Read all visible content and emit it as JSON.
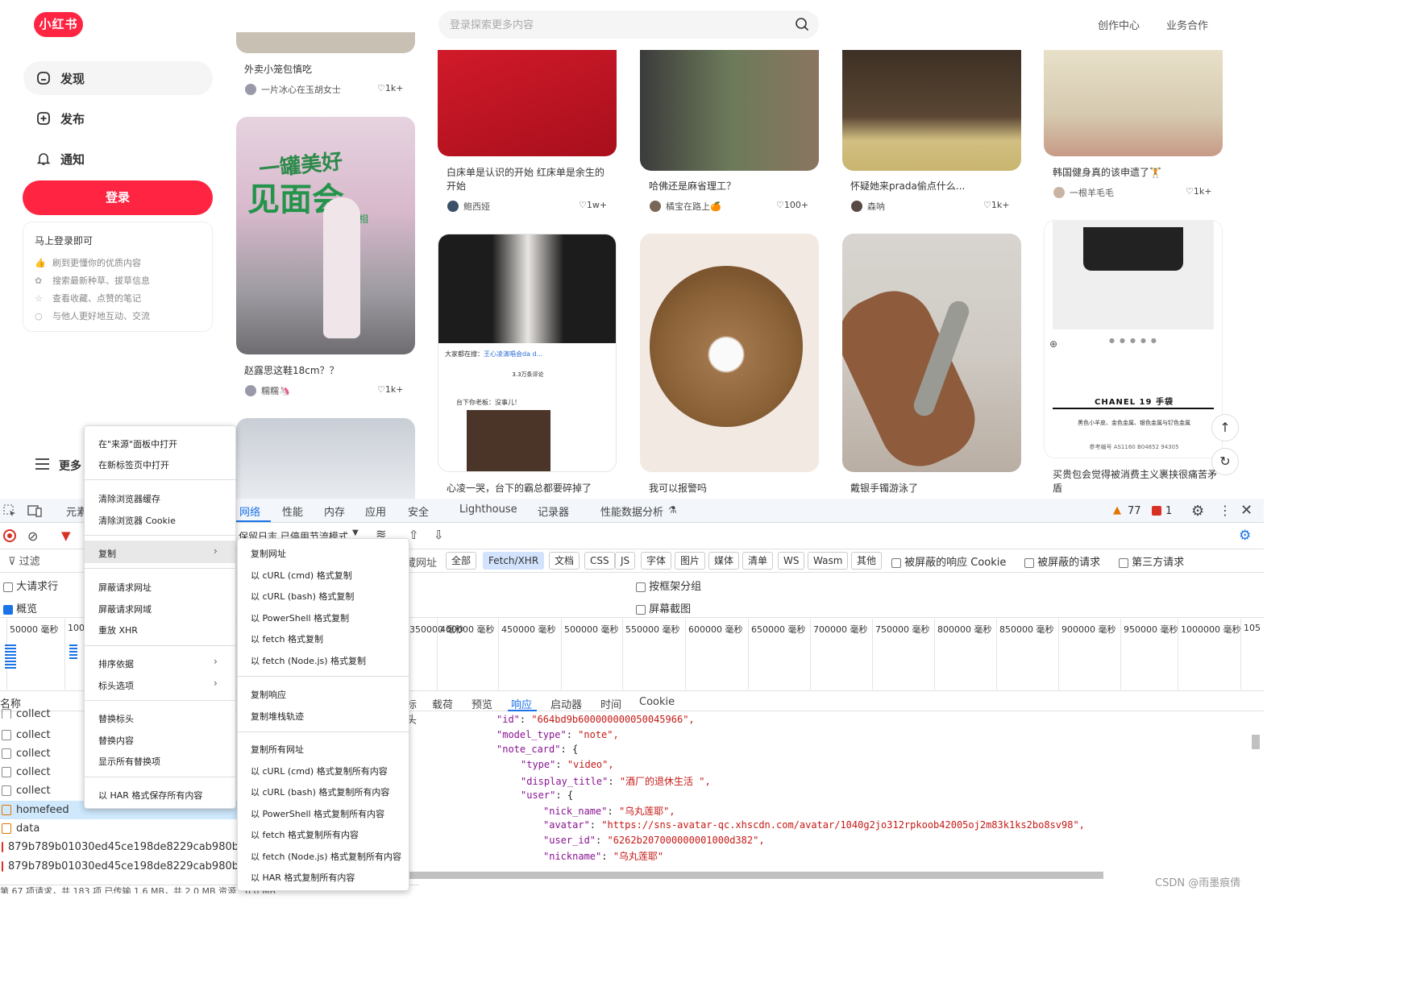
{
  "app": {
    "logo": "小红书"
  },
  "sidebar": {
    "items": [
      {
        "label": "发现"
      },
      {
        "label": "发布"
      },
      {
        "label": "通知"
      }
    ],
    "login_label": "登录",
    "login_card": {
      "title": "马上登录即可",
      "rows": [
        "刷到更懂你的优质内容",
        "搜索最新种草、拔草信息",
        "查看收藏、点赞的笔记",
        "与他人更好地互动、交流"
      ]
    },
    "more_label": "更多"
  },
  "search": {
    "placeholder": "登录探索更多内容"
  },
  "header_links": [
    "创作中心",
    "业务合作"
  ],
  "feed": {
    "cards": [
      {
        "title": "外卖小笼包慎吃",
        "author": "一片冰心在玉胡女士",
        "likes": "1k+"
      },
      {
        "title": "赵露思这鞋18cm？？",
        "author": "糯糯🦄",
        "likes": "1k+"
      },
      {
        "title": "白床单是认识的开始 红床单是余生的开始",
        "author": "鲍西娅",
        "likes": "1w+"
      },
      {
        "title": "心凌一哭，台下的霸总都要碎掉了",
        "author": "",
        "likes": ""
      },
      {
        "title": "哈佛还是麻省理工？",
        "author": "橘宝在路上🍊",
        "likes": "100+"
      },
      {
        "title": "我可以报警吗",
        "author": "",
        "likes": ""
      },
      {
        "title": "怀疑她来prada偷点什么...",
        "author": "森呐",
        "likes": "1k+"
      },
      {
        "title": "戴银手镯游泳了",
        "author": "",
        "likes": ""
      },
      {
        "title": "韩国健身真的该申遗了🏋️",
        "author": "一根羊毛毛",
        "likes": "1k+"
      },
      {
        "title": "买贵包会觉得被消费主义裹挟很痛苦矛盾",
        "author": "",
        "likes": ""
      }
    ],
    "poster_text": {
      "a": "一罐美好",
      "b": "见面会",
      "c": "约你相"
    },
    "screenshot_text": {
      "search_prefix": "大家都在搜：",
      "search_term": "王心凌演唱会da d...",
      "comment_count": "3.3万条评论",
      "comment_text": "台下你老板：没事儿！"
    },
    "chanel": {
      "title": "CHANEL 19 手袋",
      "desc": "黑色小羊皮、金色金属、银色金属与钌色金属",
      "ref": "参考编号 AS1160 B04852 94305"
    }
  },
  "devtools": {
    "tabs": [
      "元素",
      "网络",
      "性能",
      "内存",
      "应用",
      "安全",
      "Lighthouse",
      "记录器",
      "性能数据分析"
    ],
    "active_tab": "网络",
    "warnings": "77",
    "errors": "1",
    "toolbar": {
      "preserve_log": "保留日志",
      "disable_cache": "已停用节流模式"
    },
    "filter_placeholder": "过滤",
    "filter_types": [
      "全部",
      "Fetch/XHR",
      "文档",
      "CSS",
      "JS",
      "字体",
      "图片",
      "媒体",
      "清单",
      "WS",
      "Wasm",
      "其他"
    ],
    "filter_checks": [
      "被屏蔽的响应 Cookie",
      "被屏蔽的请求",
      "第三方请求"
    ],
    "hide_url": "隐藏网址",
    "big_rows": "大请求行",
    "overview": "概览",
    "group_by_frame": "按框架分组",
    "screenshots": "屏幕截图",
    "timeline_ticks": [
      "50000 毫秒",
      "1000",
      "350000 毫秒",
      "400000 毫秒",
      "450000 毫秒",
      "500000 毫秒",
      "550000 毫秒",
      "600000 毫秒",
      "650000 毫秒",
      "700000 毫秒",
      "750000 毫秒",
      "800000 毫秒",
      "850000 毫秒",
      "900000 毫秒",
      "950000 毫秒",
      "1000000 毫秒",
      "105"
    ],
    "name_header": "名称",
    "requests": [
      "collect",
      "collect",
      "collect",
      "collect",
      "collect",
      "homefeed",
      "data",
      "879b789b01030ed45ce198de8229cab980b",
      "879b789b01030ed45ce198de8229cab980b"
    ],
    "detail_tabs": [
      "标头",
      "载荷",
      "预览",
      "响应",
      "启动器",
      "时间",
      "Cookie"
    ],
    "active_detail_tab": "响应",
    "status_bar": "第 67 项请求，共 183 项   已传输 1.6 MB，共 2.0 MB   资源：6.0 MB",
    "json_lines": [
      {
        "key": "\"id\"",
        "val": "\"664bd9b600000000050045966\","
      },
      {
        "key": "\"model_type\"",
        "val": "\"note\","
      },
      {
        "key": "\"note_card\"",
        "val": "{"
      },
      {
        "key": "\"type\"",
        "val": "\"video\","
      },
      {
        "key": "\"display_title\"",
        "val": "\"酒厂的退休生活 \","
      },
      {
        "key": "\"user\"",
        "val": "{"
      },
      {
        "key": "\"nick_name\"",
        "val": "\"乌丸莲耶\","
      },
      {
        "key": "\"avatar\"",
        "val": "\"https://sns-avatar-qc.xhscdn.com/avatar/1040g2jo312rpkoob42005oj2m83k1ks2bo8sv98\","
      },
      {
        "key": "\"user_id\"",
        "val": "\"6262b207000000001000d382\","
      },
      {
        "key": "\"nickname\"",
        "val": "\"乌丸莲耶\""
      }
    ]
  },
  "context_menu": {
    "items": [
      "在\"来源\"面板中打开",
      "在新标签页中打开",
      "清除浏览器缓存",
      "清除浏览器 Cookie",
      "复制",
      "屏蔽请求网址",
      "屏蔽请求网域",
      "重放 XHR",
      "排序依据",
      "标头选项",
      "替换标头",
      "替换内容",
      "显示所有替换项",
      "以 HAR 格式保存所有内容"
    ]
  },
  "copy_submenu": {
    "items": [
      "复制网址",
      "以 cURL (cmd) 格式复制",
      "以 cURL (bash) 格式复制",
      "以 PowerShell 格式复制",
      "以 fetch 格式复制",
      "以 fetch (Node.js) 格式复制",
      "复制响应",
      "复制堆栈轨迹",
      "复制所有网址",
      "以 cURL (cmd) 格式复制所有内容",
      "以 cURL (bash) 格式复制所有内容",
      "以 PowerShell 格式复制所有内容",
      "以 fetch 格式复制所有内容",
      "以 fetch (Node.js) 格式复制所有内容",
      "以 HAR 格式复制所有内容"
    ]
  },
  "watermark": "CSDN @雨墨痕倩",
  "colors": {
    "brand": "#ff2442",
    "devtools_active": "#1a73e8"
  }
}
